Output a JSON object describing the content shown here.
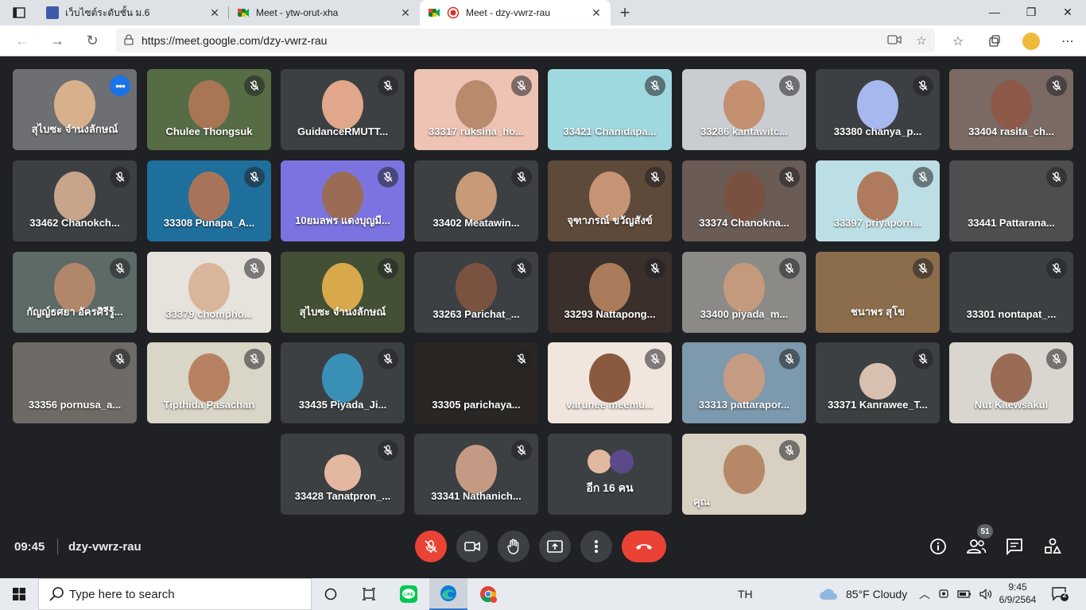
{
  "browser": {
    "tabs": [
      {
        "title": "เว็บไซต์ระดับชั้น ม.6",
        "active": false
      },
      {
        "title": "Meet - ytw-orut-xha",
        "active": false
      },
      {
        "title": "Meet - dzy-vwrz-rau",
        "active": true
      }
    ],
    "url": "https://meet.google.com/dzy-vwrz-rau"
  },
  "participants": [
    {
      "name": "สุไบซะ จำนงลักษณ์",
      "bg": "#6d6f72",
      "skin": "#d9b08c",
      "pinned": true
    },
    {
      "name": "Chulee Thongsuk",
      "bg": "#566c44",
      "skin": "#a87555"
    },
    {
      "name": "GuidanceRMUTT...",
      "bg": "#3c4043",
      "skin": "#e0a78a"
    },
    {
      "name": "33317 ruksina_ho...",
      "bg": "#eec3b3",
      "skin": "#b98a6b"
    },
    {
      "name": "33421 Chanidapa...",
      "bg": "#9fd8de",
      "skin": ""
    },
    {
      "name": "33286 kantawitc...",
      "bg": "#c9ccd0",
      "skin": "#c49070"
    },
    {
      "name": "33380 chanya_p...",
      "bg": "#3c4043",
      "skin": "#a7b8ef"
    },
    {
      "name": "33404 rasita_ch...",
      "bg": "#7a6a63",
      "skin": "#8d5a49"
    },
    {
      "name": "33462 Chanokch...",
      "bg": "#3c4043",
      "skin": "#c8a58a"
    },
    {
      "name": "33308 Punapa_A...",
      "bg": "#1f6f9c",
      "skin": "#a87459"
    },
    {
      "name": "10ยมลพร แดงบุญมี...",
      "bg": "#7b74e0",
      "skin": "#9a6c55"
    },
    {
      "name": "33402 Meatawin...",
      "bg": "#3c4043",
      "skin": "#c89a78"
    },
    {
      "name": "จุฑาภรณ์ ขวัญสังข์",
      "bg": "#5e4a3a",
      "skin": "#c49474"
    },
    {
      "name": "33374 Chanokna...",
      "bg": "#6b5b55",
      "skin": "#7a5040"
    },
    {
      "name": "33397 priyaporn...",
      "bg": "#bcdfe6",
      "skin": "#b07a5e"
    },
    {
      "name": "33441 Pattarana...",
      "bg": "#4c4e50",
      "skin": ""
    },
    {
      "name": "กัญญ์ธศยา อัครศิรีรู้...",
      "bg": "#5d6a66",
      "skin": "#b2866a"
    },
    {
      "name": "33379 chompho...",
      "bg": "#e6e2dc",
      "skin": "#d8b59b"
    },
    {
      "name": "สุไบซะ จำนงลักษณ์",
      "bg": "#445035",
      "skin": "#d7a94a"
    },
    {
      "name": "33263 Parichat_...",
      "bg": "#3c4043",
      "skin": "#7a5240"
    },
    {
      "name": "33293 Nattapong...",
      "bg": "#3a2f2a",
      "skin": "#a97b5a"
    },
    {
      "name": "33400 piyada_m...",
      "bg": "#8c8a86",
      "skin": "#c49a7c"
    },
    {
      "name": "ชนาพร สุโข",
      "bg": "#8b6d4b",
      "skin": ""
    },
    {
      "name": "33301 nontapat_...",
      "bg": "#3c4043",
      "skin": ""
    },
    {
      "name": "33356 pornusa_a...",
      "bg": "#6e6a66",
      "skin": ""
    },
    {
      "name": "Tipthida Pasachan",
      "bg": "#d9d5c7",
      "skin": "#b78262"
    },
    {
      "name": "33435 Piyada_Ji...",
      "bg": "#3c4043",
      "skin": "#3a8fb7"
    },
    {
      "name": "33305 parichaya...",
      "bg": "#2a2624",
      "skin": ""
    },
    {
      "name": "varunee meemu...",
      "bg": "#f1e6de",
      "skin": "#8a5a40"
    },
    {
      "name": "33313 pattarapor...",
      "bg": "#7d99ad",
      "skin": "#c59c82"
    },
    {
      "name": "33371 Kanrawee_T...",
      "bg": "#3c4043",
      "skin": "#d8c0b0",
      "avatar": true
    },
    {
      "name": "Nut Kaewsakul",
      "bg": "#d8d6ce",
      "skin": "#9a6b55"
    },
    {
      "name": "33428 Tanatpron_...",
      "bg": "#3c4043",
      "skin": "#e4b8a0",
      "avatar": true
    },
    {
      "name": "33341 Nathanich...",
      "bg": "#3c4043",
      "skin": "#c49a84"
    },
    {
      "name": "อีก 16 คน",
      "bg": "#3c4043",
      "skin": "",
      "others": true
    },
    {
      "name": "คุณ",
      "bg": "#d8d0c2",
      "skin": "#b68868"
    }
  ],
  "meeting": {
    "time": "09:45",
    "code": "dzy-vwrz-rau",
    "participant_count": "51"
  },
  "taskbar": {
    "search_placeholder": "Type here to search",
    "lang": "TH",
    "weather": "85°F  Cloudy",
    "time": "9:45",
    "date": "6/9/2564",
    "notifications": "2"
  },
  "colors": {
    "hangup": "#ea4335",
    "accent": "#1a73e8"
  }
}
